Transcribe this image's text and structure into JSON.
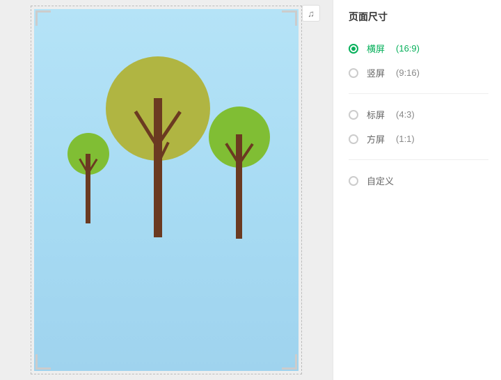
{
  "panel": {
    "title": "页面尺寸",
    "selected": 0,
    "groups": [
      [
        {
          "label": "横屏",
          "ratio": "(16:9)"
        },
        {
          "label": "竖屏",
          "ratio": "(9:16)"
        }
      ],
      [
        {
          "label": "标屏",
          "ratio": "(4:3)"
        },
        {
          "label": "方屏",
          "ratio": "(1:1)"
        }
      ],
      [
        {
          "label": "自定义",
          "ratio": ""
        }
      ]
    ]
  },
  "icons": {
    "music": "♫"
  }
}
